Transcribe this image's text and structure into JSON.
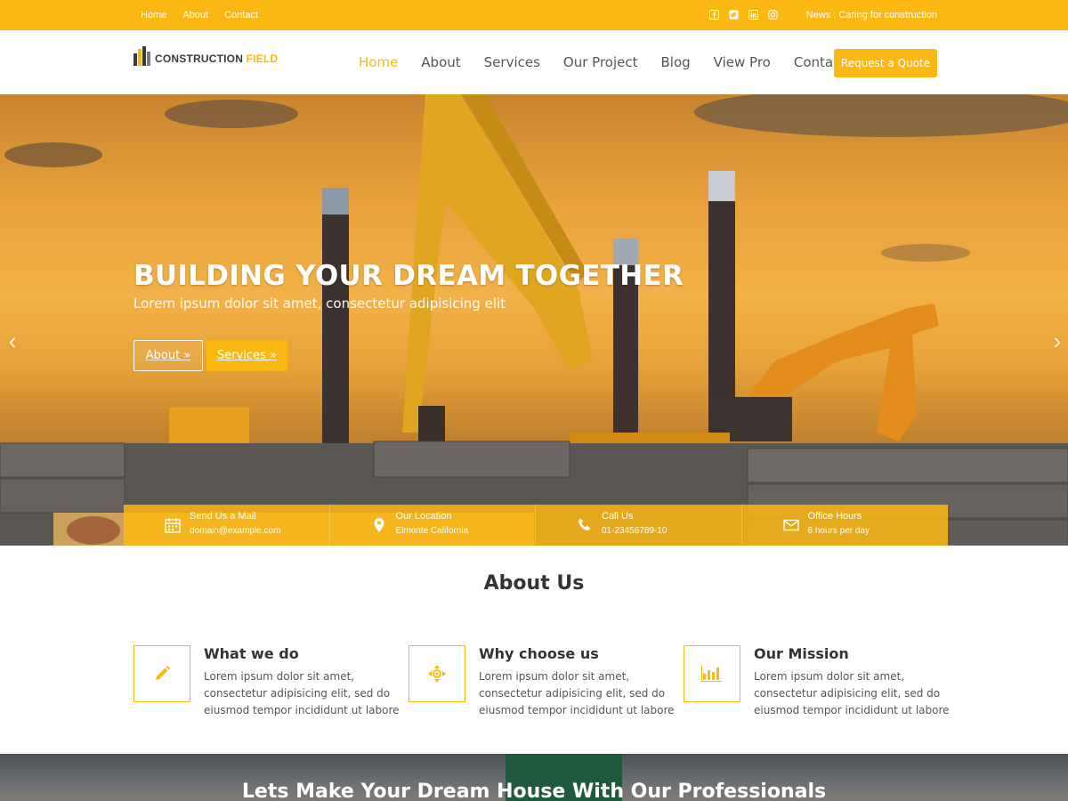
{
  "topbar": {
    "links": [
      "Home",
      "About",
      "Contact"
    ],
    "social_icons": [
      "facebook-icon",
      "twitter-icon",
      "linkedin-icon",
      "instagram-icon"
    ],
    "news": "News : Caring for construction"
  },
  "header": {
    "logo": {
      "text_main": "CONSTRUCTION ",
      "text_accent": "FIELD"
    },
    "nav": [
      {
        "label": "Home",
        "active": true
      },
      {
        "label": "About",
        "active": false
      },
      {
        "label": "Services",
        "active": false
      },
      {
        "label": "Our Project",
        "active": false
      },
      {
        "label": "Blog",
        "active": false
      },
      {
        "label": "View Pro",
        "active": false
      },
      {
        "label": "Contact",
        "active": false
      }
    ],
    "quote_button": "Request a Quote"
  },
  "hero": {
    "title": "BUILDING YOUR DREAM TOGETHER",
    "subtitle": "Lorem ipsum dolor sit amet, consectetur adipisicing elit",
    "buttons": {
      "about": "About »",
      "services": "Services »"
    },
    "arrow_left": "‹",
    "arrow_right": "›"
  },
  "info": [
    {
      "icon": "calendar-icon",
      "title": "Send Us a Mail",
      "detail": "domain@example.com"
    },
    {
      "icon": "location-pin-icon",
      "title": "Our Location",
      "detail": "Elmonte California"
    },
    {
      "icon": "phone-icon",
      "title": "Call Us",
      "detail": "01-23456789-10"
    },
    {
      "icon": "envelope-icon",
      "title": "Office Hours",
      "detail": "8 hours per day"
    }
  ],
  "about": {
    "title": "About Us",
    "features": [
      {
        "icon": "pencil-icon",
        "title": "What we do",
        "text": "Lorem ipsum dolor sit amet, consectetur adipisicing elit, sed do eiusmod tempor incididunt ut labore"
      },
      {
        "icon": "target-arrows-icon",
        "title": "Why choose us",
        "text": "Lorem ipsum dolor sit amet, consectetur adipisicing elit, sed do eiusmod tempor incididunt ut labore"
      },
      {
        "icon": "bar-chart-icon",
        "title": "Our Mission",
        "text": "Lorem ipsum dolor sit amet, consectetur adipisicing elit, sed do eiusmod tempor incididunt ut labore"
      }
    ]
  },
  "banner": {
    "title": "Lets Make Your Dream House With Our Professionals"
  },
  "colors": {
    "accent": "#fbb813",
    "text_dark": "#333333",
    "text_body": "#555555"
  }
}
